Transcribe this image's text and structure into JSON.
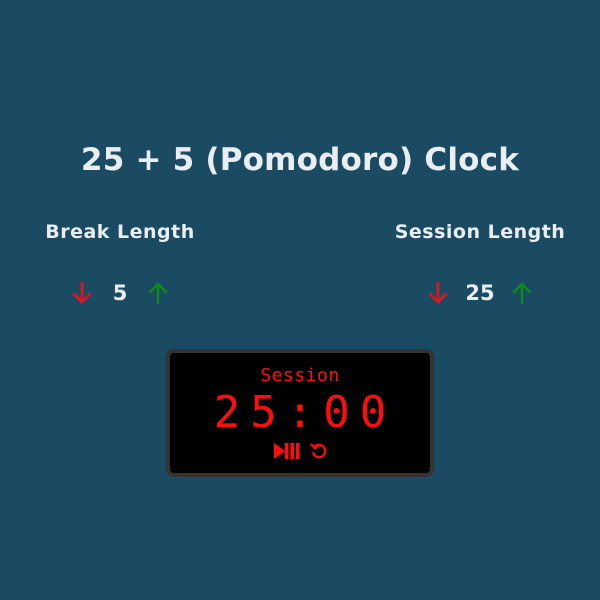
{
  "title": "25 + 5 (Pomodoro) Clock",
  "break": {
    "label": "Break Length",
    "value": "5",
    "decrement_icon": "arrow-down-icon",
    "increment_icon": "arrow-up-icon"
  },
  "session": {
    "label": "Session Length",
    "value": "25",
    "decrement_icon": "arrow-down-icon",
    "increment_icon": "arrow-up-icon"
  },
  "timer": {
    "label": "Session",
    "time_left": "25:00",
    "play_pause_icon": "play-pause-icon",
    "reset_icon": "refresh-icon"
  },
  "colors": {
    "background": "#1b4a63",
    "decrement": "#e5141a",
    "increment": "#0e8a1a",
    "timer_text": "#ff0d0d"
  }
}
